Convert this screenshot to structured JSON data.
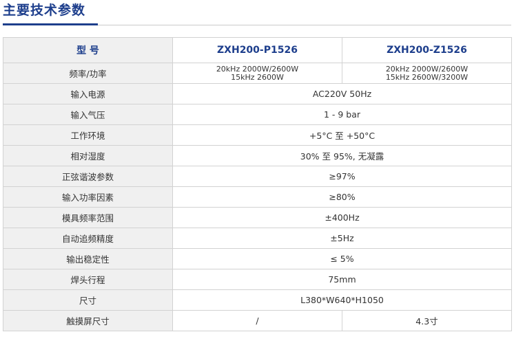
{
  "title": "主要技术参数",
  "header": {
    "label": "型 号",
    "model_a": "ZXH200-P1526",
    "model_b": "ZXH200-Z1526"
  },
  "freq_power": {
    "label": "频率/功率",
    "a_line1": "20kHz 2000W/2600W",
    "a_line2": "15kHz 2600W",
    "b_line1": "20kHz 2000W/2600W",
    "b_line2": "15kHz 2600W/3200W"
  },
  "rows": [
    {
      "label": "输入电源",
      "value": "AC220V 50Hz"
    },
    {
      "label": "输入气压",
      "value": "1 - 9 bar"
    },
    {
      "label": "工作环境",
      "value": "+5°C 至 +50°C"
    },
    {
      "label": "相对湿度",
      "value": "30% 至 95%, 无凝露"
    },
    {
      "label": "正弦谐波参数",
      "value": "≥97%"
    },
    {
      "label": "输入功率因素",
      "value": "≥80%"
    },
    {
      "label": "模具频率范围",
      "value": "±400Hz"
    },
    {
      "label": "自动追频精度",
      "value": "±5Hz"
    },
    {
      "label": "输出稳定性",
      "value": "≤ 5%"
    },
    {
      "label": "焊头行程",
      "value": "75mm"
    },
    {
      "label": "尺寸",
      "value": "L380*W640*H1050"
    }
  ],
  "touch": {
    "label": "触摸屏尺寸",
    "a": "/",
    "b": "4.3寸"
  }
}
